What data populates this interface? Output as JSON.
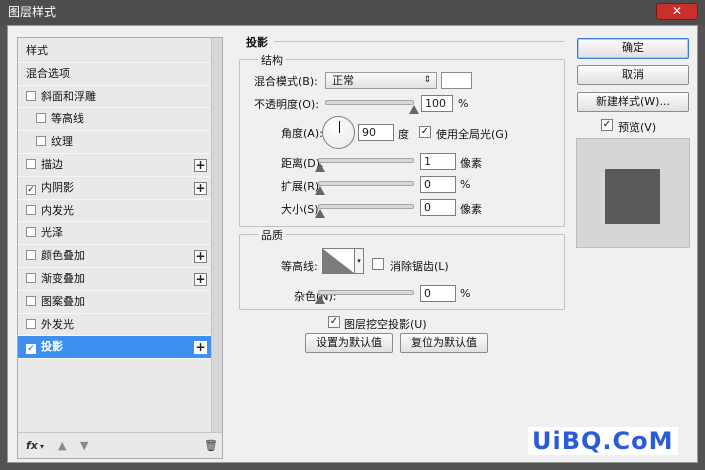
{
  "window": {
    "title": "图层样式",
    "close_glyph": "✕"
  },
  "left_panel": {
    "items": [
      {
        "label": "样式",
        "checkbox": false,
        "plus": false,
        "indent": false,
        "selected": false
      },
      {
        "label": "混合选项",
        "checkbox": false,
        "plus": false,
        "indent": false,
        "selected": false
      },
      {
        "label": "斜面和浮雕",
        "checkbox": true,
        "checked": false,
        "plus": false,
        "indent": false,
        "selected": false
      },
      {
        "label": "等高线",
        "checkbox": true,
        "checked": false,
        "plus": false,
        "indent": true,
        "selected": false
      },
      {
        "label": "纹理",
        "checkbox": true,
        "checked": false,
        "plus": false,
        "indent": true,
        "selected": false
      },
      {
        "label": "描边",
        "checkbox": true,
        "checked": false,
        "plus": true,
        "indent": false,
        "selected": false
      },
      {
        "label": "内阴影",
        "checkbox": true,
        "checked": true,
        "plus": true,
        "indent": false,
        "selected": false
      },
      {
        "label": "内发光",
        "checkbox": true,
        "checked": false,
        "plus": false,
        "indent": false,
        "selected": false
      },
      {
        "label": "光泽",
        "checkbox": true,
        "checked": false,
        "plus": false,
        "indent": false,
        "selected": false
      },
      {
        "label": "颜色叠加",
        "checkbox": true,
        "checked": false,
        "plus": true,
        "indent": false,
        "selected": false
      },
      {
        "label": "渐变叠加",
        "checkbox": true,
        "checked": false,
        "plus": true,
        "indent": false,
        "selected": false
      },
      {
        "label": "图案叠加",
        "checkbox": true,
        "checked": false,
        "plus": false,
        "indent": false,
        "selected": false
      },
      {
        "label": "外发光",
        "checkbox": true,
        "checked": false,
        "plus": false,
        "indent": false,
        "selected": false
      },
      {
        "label": "投影",
        "checkbox": true,
        "checked": true,
        "plus": true,
        "indent": false,
        "selected": true
      }
    ],
    "footer": {
      "fx": "fx",
      "fx_arrow": "▾",
      "up": "▲",
      "down": "▼",
      "trash": "🗑"
    }
  },
  "panel": {
    "section_title": "投影",
    "structure": {
      "legend": "结构",
      "blend_mode_label": "混合模式(B):",
      "blend_mode_value": "正常",
      "opacity_label": "不透明度(O):",
      "opacity_value": "100",
      "opacity_unit": "%",
      "angle_label": "角度(A):",
      "angle_value": "90",
      "angle_unit": "度",
      "global_light_label": "使用全局光(G)",
      "global_light_checked": true,
      "distance_label": "距离(D):",
      "distance_value": "1",
      "distance_unit": "像素",
      "spread_label": "扩展(R):",
      "spread_value": "0",
      "spread_unit": "%",
      "size_label": "大小(S):",
      "size_value": "0",
      "size_unit": "像素"
    },
    "quality": {
      "legend": "品质",
      "contour_label": "等高线:",
      "antialias_label": "消除锯齿(L)",
      "antialias_checked": false,
      "noise_label": "杂色(N):",
      "noise_value": "0",
      "noise_unit": "%"
    },
    "knockout_label": "图层挖空投影(U)",
    "knockout_checked": true,
    "make_default": "设置为默认值",
    "reset_default": "复位为默认值"
  },
  "buttons": {
    "ok": "确定",
    "cancel": "取消",
    "new_style": "新建样式(W)...",
    "preview_label": "预览(V)",
    "preview_checked": true
  },
  "colors": {
    "accent": "#3d8ff0",
    "shadow_swatch": "#ffffff",
    "preview_square": "#5a5a5a"
  },
  "watermark": "UiBQ.CoM",
  "icons": {
    "selected_select_arrow": "⇕",
    "contour_dropdown": "▾"
  }
}
